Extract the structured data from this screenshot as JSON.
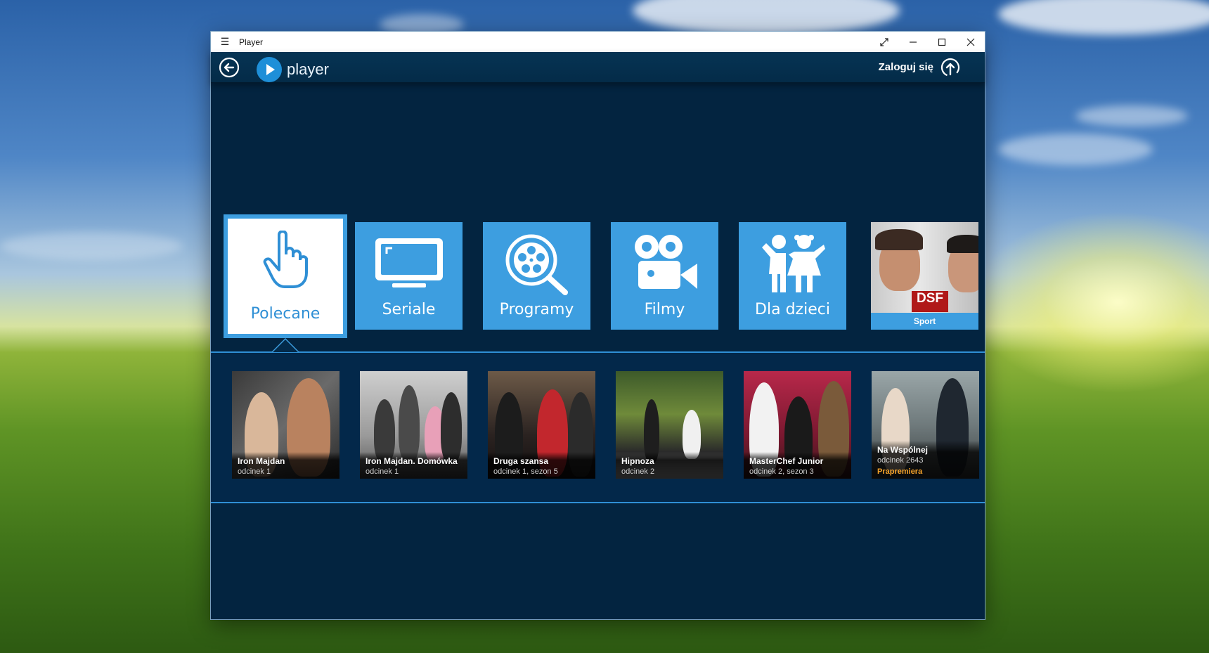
{
  "window": {
    "title": "Player"
  },
  "appbar": {
    "logo_text": "player",
    "login_label": "Zaloguj się"
  },
  "categories": [
    {
      "label": "Polecane",
      "icon": "hand-pointer-icon",
      "selected": true
    },
    {
      "label": "Seriale",
      "icon": "tv-icon"
    },
    {
      "label": "Programy",
      "icon": "film-reel-search-icon"
    },
    {
      "label": "Filmy",
      "icon": "movie-camera-icon"
    },
    {
      "label": "Dla dzieci",
      "icon": "kids-icon"
    },
    {
      "label": "Sport",
      "icon": "sport-thumbnail"
    }
  ],
  "sport_logo_text": "DSF",
  "recommended": [
    {
      "title": "Iron Majdan",
      "subtitle": "odcinek 1"
    },
    {
      "title": "Iron Majdan. Domówka",
      "subtitle": "odcinek 1"
    },
    {
      "title": "Druga szansa",
      "subtitle": "odcinek 1, sezon 5"
    },
    {
      "title": "Hipnoza",
      "subtitle": "odcinek 2"
    },
    {
      "title": "MasterChef Junior",
      "subtitle": "odcinek 2, sezon 3"
    },
    {
      "title": "Na Wspólnej",
      "subtitle": "odcinek 2643",
      "badge": "Prapremiera"
    }
  ],
  "colors": {
    "app_background": "#032440",
    "tile_blue": "#3d9ee0",
    "accent_line": "#2f8fd5",
    "badge_orange": "#f7a42a"
  }
}
